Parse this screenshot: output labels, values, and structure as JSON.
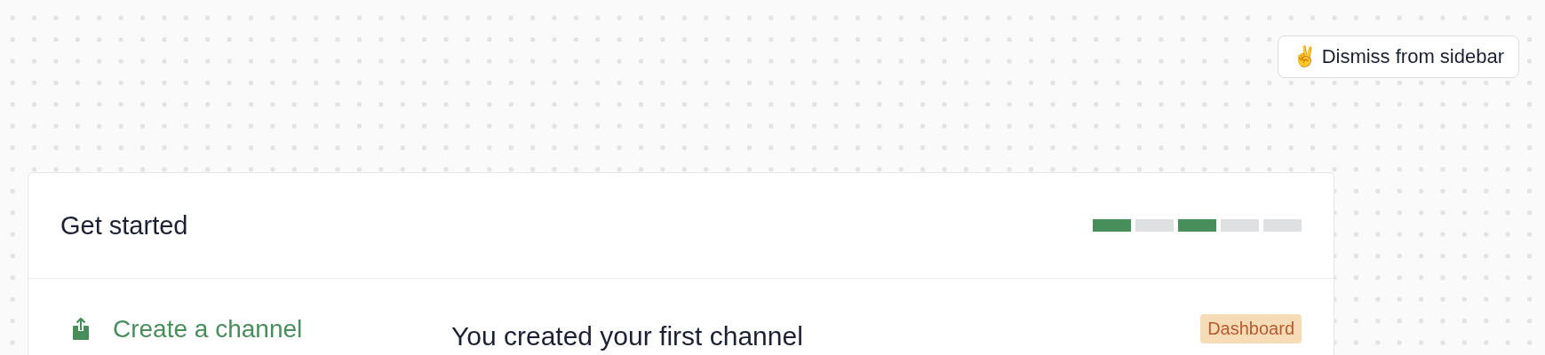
{
  "dismiss_button": {
    "emoji": "✌️",
    "label": "Dismiss from sidebar"
  },
  "card": {
    "title": "Get started",
    "progress_steps": [
      {
        "done": true
      },
      {
        "done": false
      },
      {
        "done": true
      },
      {
        "done": false
      },
      {
        "done": false
      }
    ],
    "tasks": [
      {
        "label": "Create a channel",
        "selected": true
      }
    ],
    "detail": {
      "title": "You created your first channel",
      "badge": "Dashboard"
    }
  }
}
